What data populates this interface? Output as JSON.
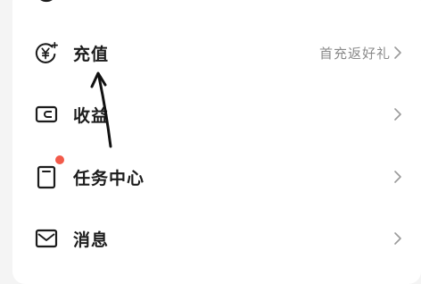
{
  "menu": {
    "items": [
      {
        "label": "充值",
        "extra": "首充返好礼",
        "icon": "yen-sparkle-icon"
      },
      {
        "label": "收益",
        "extra": "",
        "icon": "wallet-icon"
      },
      {
        "label": "任务中心",
        "extra": "",
        "icon": "clipboard-icon",
        "badge": "red-dot"
      },
      {
        "label": "消息",
        "extra": "",
        "icon": "mail-icon"
      }
    ]
  },
  "colors": {
    "text": "#1c1c1c",
    "secondary": "#8a8a8a",
    "badge": "#f25a4a",
    "background": "#f4f4f4",
    "panel": "#ffffff"
  }
}
